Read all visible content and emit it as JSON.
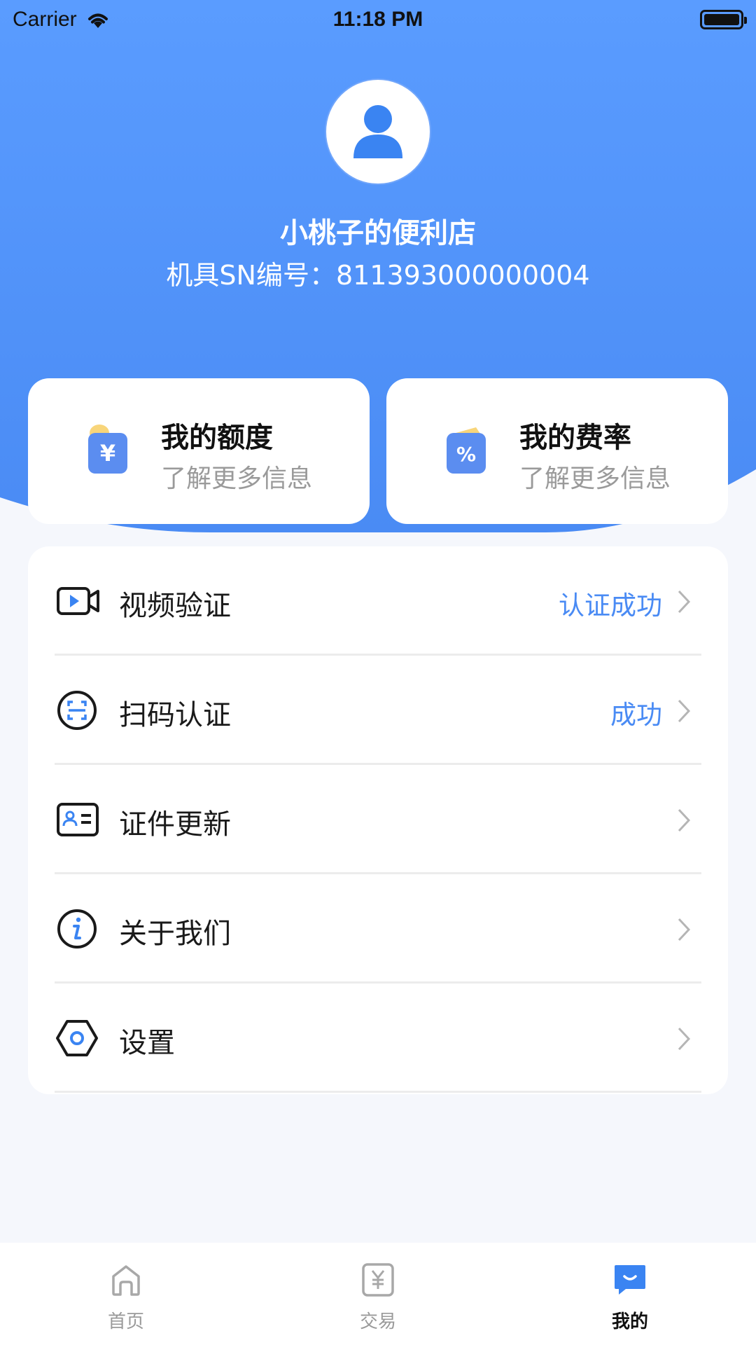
{
  "status_bar": {
    "carrier": "Carrier",
    "time": "11:18 PM"
  },
  "profile": {
    "store_name": "小桃子的便利店",
    "sn_label": "机具SN编号：",
    "sn_value": "811393000000004"
  },
  "cards": [
    {
      "title": "我的额度",
      "subtitle": "了解更多信息",
      "icon": "yuan-wallet-icon"
    },
    {
      "title": "我的费率",
      "subtitle": "了解更多信息",
      "icon": "percent-wallet-icon"
    }
  ],
  "menu": [
    {
      "label": "视频验证",
      "status": "认证成功",
      "icon": "video-icon"
    },
    {
      "label": "扫码认证",
      "status": "成功",
      "icon": "scan-icon"
    },
    {
      "label": "证件更新",
      "status": "",
      "icon": "id-card-icon"
    },
    {
      "label": "关于我们",
      "status": "",
      "icon": "info-icon"
    },
    {
      "label": "设置",
      "status": "",
      "icon": "settings-icon"
    }
  ],
  "tabs": [
    {
      "label": "首页",
      "icon": "home-icon",
      "active": false
    },
    {
      "label": "交易",
      "icon": "yuan-icon",
      "active": false
    },
    {
      "label": "我的",
      "icon": "profile-chat-icon",
      "active": true
    }
  ],
  "colors": {
    "primary": "#4a8bf4",
    "status_text": "#4a8bf4",
    "background": "#f5f7fc"
  }
}
